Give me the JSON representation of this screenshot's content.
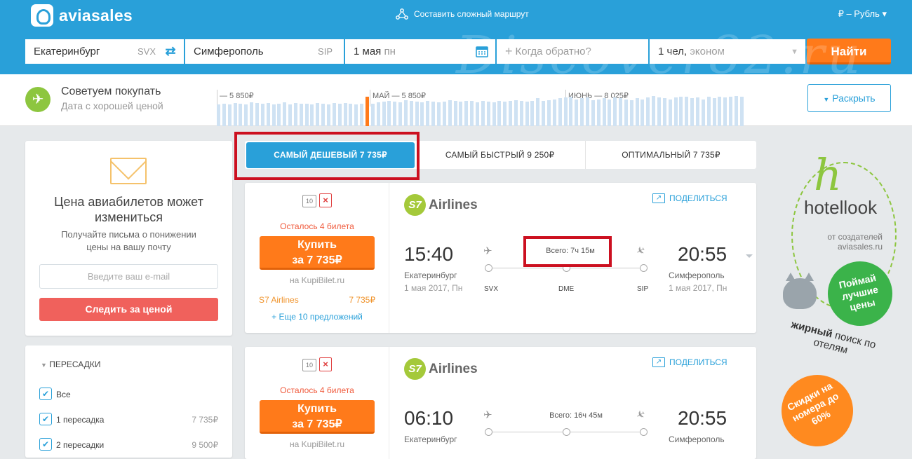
{
  "header": {
    "logo": "aviasales",
    "complex_route": "Составить сложный маршрут",
    "currency": "₽ – Рубль"
  },
  "search": {
    "from_city": "Екатеринбург",
    "from_code": "SVX",
    "to_city": "Симферополь",
    "to_code": "SIP",
    "depart_date": "1 мая",
    "depart_dow": "пн",
    "return_placeholder": "Когда обратно?",
    "passengers": "1 чел,",
    "cabin": "эконом",
    "find_label": "Найти"
  },
  "advice": {
    "title": "Советуем покупать",
    "subtitle": "Дата с хорошей ценой",
    "expand_label": "Раскрыть",
    "month_labels": [
      "— 5 850₽",
      "МАЙ — 5 850₽",
      "ИЮНЬ — 8 025₽"
    ],
    "bar_levels": [
      0.6,
      0.62,
      0.6,
      0.64,
      0.62,
      0.6,
      0.66,
      0.63,
      0.61,
      0.64,
      0.6,
      0.62,
      0.65,
      0.6,
      0.63,
      0.61,
      0.62,
      0.6,
      0.64,
      0.62,
      0.6,
      0.63,
      0.61,
      0.64,
      0.62,
      0.6,
      0.62,
      0.8,
      0.62,
      0.66,
      0.68,
      0.7,
      0.68,
      0.66,
      0.72,
      0.7,
      0.68,
      0.66,
      0.7,
      0.68,
      0.66,
      0.67,
      0.72,
      0.7,
      0.68,
      0.69,
      0.7,
      0.66,
      0.7,
      0.68,
      0.66,
      0.7,
      0.68,
      0.7,
      0.72,
      0.7,
      0.68,
      0.7,
      0.76,
      0.7,
      0.72,
      0.74,
      0.76,
      0.78,
      0.8,
      0.74,
      0.76,
      0.78,
      0.72,
      0.74,
      0.76,
      0.74,
      0.78,
      0.76,
      0.74,
      0.72,
      0.76,
      0.74,
      0.78,
      0.82,
      0.78,
      0.76,
      0.74,
      0.78,
      0.8,
      0.8,
      0.76,
      0.78,
      0.74,
      0.8,
      0.76,
      0.8,
      0.78,
      0.8,
      0.82,
      0.8
    ],
    "selected_bar": 27
  },
  "subscribe": {
    "title": "Цена авиабилетов может измениться",
    "subtitle": "Получайте письма о понижении цены на вашу почту",
    "email_placeholder": "Введите ваш e-mail",
    "follow_label": "Следить за ценой"
  },
  "filters": {
    "title": "ПЕРЕСАДКИ",
    "items": [
      {
        "label": "Все",
        "value": ""
      },
      {
        "label": "1 пересадка",
        "value": "7 735₽"
      },
      {
        "label": "2 пересадки",
        "value": "9 500₽"
      }
    ]
  },
  "tabs": [
    {
      "label": "САМЫЙ ДЕШЕВЫЙ 7 735₽"
    },
    {
      "label": "САМЫЙ БЫСТРЫЙ 9 250₽"
    },
    {
      "label": "ОПТИМАЛЬНЫЙ 7 735₽"
    }
  ],
  "tickets": [
    {
      "baggage": "10",
      "left_tickets": "Осталось 4 билета",
      "buy_line1": "Купить",
      "buy_line2": "за 7 735₽",
      "via": "на KupiBilet.ru",
      "agent_name": "S7 Airlines",
      "agent_price": "7 735₽",
      "more_offers": "+ Еще 10 предложений",
      "airline_mark": "S7",
      "airline_name": "Airlines",
      "share": "ПОДЕЛИТЬСЯ",
      "dep_time": "15:40",
      "dep_city": "Екатеринбург",
      "dep_date": "1 мая 2017, Пн",
      "arr_time": "20:55",
      "arr_city": "Симферополь",
      "arr_date": "1 мая 2017, Пн",
      "total": "Всего: 7ч 15м",
      "codes": [
        "SVX",
        "DME",
        "SIP"
      ]
    },
    {
      "baggage": "10",
      "left_tickets": "Осталось 4 билета",
      "buy_line1": "Купить",
      "buy_line2": "за 7 735₽",
      "via": "на KupiBilet.ru",
      "airline_mark": "S7",
      "airline_name": "Airlines",
      "share": "ПОДЕЛИТЬСЯ",
      "dep_time": "06:10",
      "dep_city": "Екатеринбург",
      "arr_time": "20:55",
      "arr_city": "Симферополь",
      "total": "Всего: 16ч 45м"
    }
  ],
  "ad": {
    "brand": "hotellook",
    "byline": "от создателей aviasales.ru",
    "green_circle": "Поймай лучшие цены",
    "bold_word": "Жирный",
    "rest_line": "поиск по отелям",
    "orange_circle": "Скидки на номера до 60%"
  },
  "watermark": "Discover82.ru"
}
